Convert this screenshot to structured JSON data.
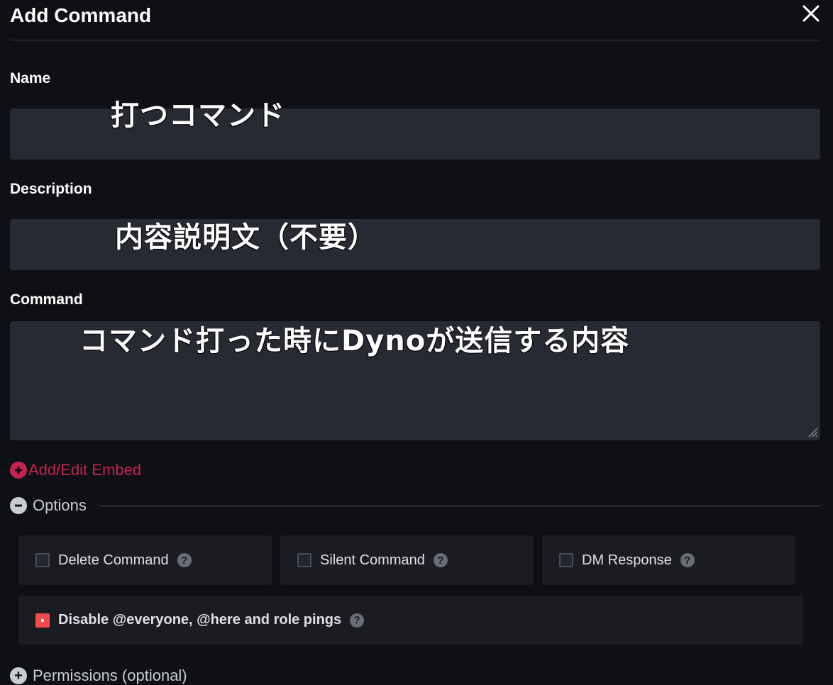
{
  "dialog": {
    "title": "Add Command"
  },
  "fields": {
    "name": {
      "label": "Name",
      "value": "",
      "annotation": "打つコマンド"
    },
    "description": {
      "label": "Description",
      "value": "",
      "annotation": "内容説明文（不要）"
    },
    "command": {
      "label": "Command",
      "value": "",
      "annotation": "コマンド打った時にDynoが送信する内容"
    }
  },
  "embed_link": {
    "label": "Add/Edit Embed",
    "icon": "plus-circle-icon"
  },
  "options": {
    "label": "Options",
    "icon": "minus-circle-icon",
    "items": [
      {
        "label": "Delete Command",
        "checked": false
      },
      {
        "label": "Silent Command",
        "checked": false
      },
      {
        "label": "DM Response",
        "checked": false
      }
    ],
    "wide_item": {
      "label": "Disable @everyone, @here and role pings",
      "checked": true
    }
  },
  "permissions": {
    "label": "Permissions (optional)",
    "icon": "plus-circle-icon"
  },
  "colors": {
    "accent": "#c4234f",
    "checkbox_checked": "#f04a4a",
    "field_bg": "#272a33",
    "background": "#0f1015"
  }
}
